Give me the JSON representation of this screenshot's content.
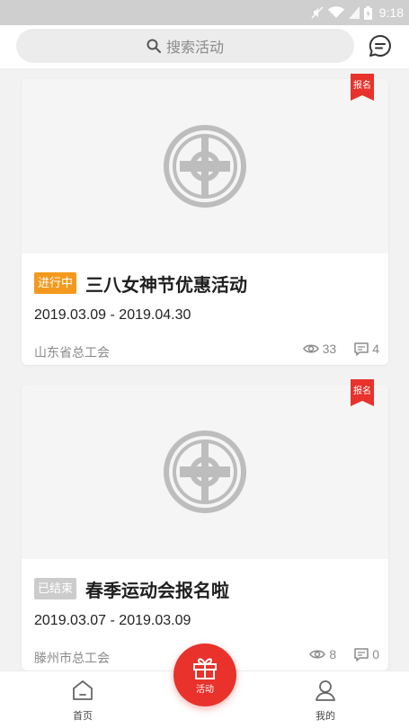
{
  "status_bar": {
    "time": "9:18"
  },
  "search": {
    "placeholder": "搜索活动"
  },
  "activities": [
    {
      "ribbon": "报名",
      "status": "进行中",
      "status_type": "ongoing",
      "title": "三八女神节优惠活动",
      "dates": "2019.03.09  -  2019.04.30",
      "organizer": "山东省总工会",
      "views": "33",
      "comments": "4"
    },
    {
      "ribbon": "报名",
      "status": "已结束",
      "status_type": "ended",
      "title": "春季运动会报名啦",
      "dates": "2019.03.07  -  2019.03.09",
      "organizer": "滕州市总工会",
      "views": "8",
      "comments": "0"
    }
  ],
  "tabs": {
    "home": "首页",
    "activity": "活动",
    "mine": "我的"
  },
  "colors": {
    "accent": "#e8322b",
    "ongoing": "#f39a1e",
    "ended": "#cccccc"
  }
}
